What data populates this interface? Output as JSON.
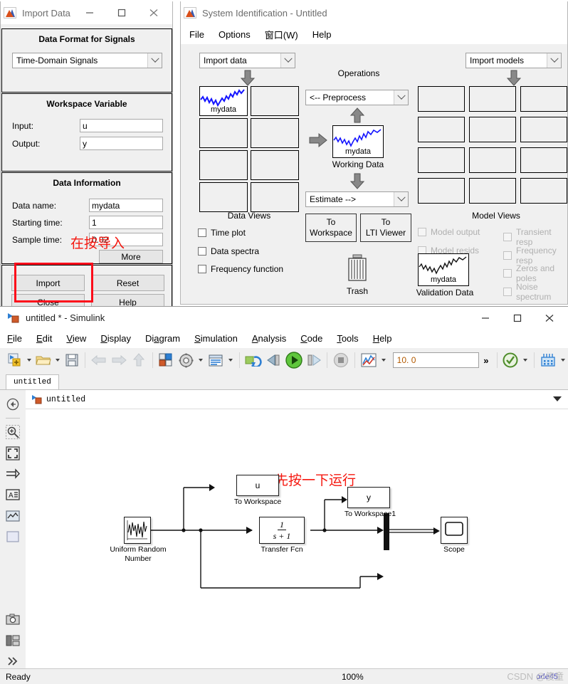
{
  "import_window": {
    "title": "Import Data",
    "icon": "matlab-icon",
    "window_controls": [
      "minimize",
      "maximize",
      "close"
    ],
    "data_format": {
      "header": "Data Format for Signals",
      "selected": "Time-Domain Signals"
    },
    "workspace_variable": {
      "header": "Workspace Variable",
      "input_label": "Input:",
      "input_value": "u",
      "output_label": "Output:",
      "output_value": "y"
    },
    "data_information": {
      "header": "Data Information",
      "data_name_label": "Data name:",
      "data_name_value": "mydata",
      "starting_time_label": "Starting time:",
      "starting_time_value": "1",
      "sample_time_label": "Sample time:",
      "sample_time_value": "0.02",
      "more_label": "More"
    },
    "buttons": {
      "import": "Import",
      "reset": "Reset",
      "close": "Close",
      "help": "Help"
    },
    "annotation": "在按导入",
    "highlight_color": "#fc0d1b"
  },
  "sysid_window": {
    "title": "System Identification - Untitled",
    "icon": "matlab-icon",
    "menus": [
      "File",
      "Options",
      "窗口(W)",
      "Help"
    ],
    "import_data_combo": "Import data",
    "import_models_combo": "Import models",
    "operations_label": "Operations",
    "preprocess_combo": "<-- Preprocess",
    "estimate_combo": "Estimate -->",
    "working_data_caption": "Working Data",
    "working_data_name": "mydata",
    "validation_data_caption": "Validation Data",
    "validation_data_name": "mydata",
    "to_workspace_button": "To Workspace",
    "to_lti_viewer_button": "To LTI Viewer",
    "trash_label": "Trash",
    "data_views": {
      "header": "Data Views",
      "items": [
        {
          "label": "Time plot",
          "checked": false,
          "enabled": true
        },
        {
          "label": "Data spectra",
          "checked": false,
          "enabled": true
        },
        {
          "label": "Frequency function",
          "checked": false,
          "enabled": true
        }
      ]
    },
    "model_views": {
      "header": "Model Views",
      "left_items": [
        {
          "label": "Model output",
          "checked": false,
          "enabled": false
        },
        {
          "label": "Model resids",
          "checked": false,
          "enabled": false
        }
      ],
      "right_items": [
        {
          "label": "Transient resp",
          "checked": false,
          "enabled": false
        },
        {
          "label": "Frequency resp",
          "checked": false,
          "enabled": false
        },
        {
          "label": "Zeros and poles",
          "checked": false,
          "enabled": false
        },
        {
          "label": "Noise spectrum",
          "checked": false,
          "enabled": false
        }
      ]
    },
    "data_board_slots": 8,
    "model_board_slots": 12
  },
  "simulink_window": {
    "title": "untitled * - Simulink",
    "icon": "simulink-icon",
    "window_controls": [
      "minimize",
      "maximize",
      "close"
    ],
    "menus": [
      {
        "label": "File",
        "mnemonic": "F"
      },
      {
        "label": "Edit",
        "mnemonic": "E"
      },
      {
        "label": "View",
        "mnemonic": "V"
      },
      {
        "label": "Display",
        "mnemonic": "D"
      },
      {
        "label": "Diagram",
        "mnemonic": "a"
      },
      {
        "label": "Simulation",
        "mnemonic": "S"
      },
      {
        "label": "Analysis",
        "mnemonic": "A"
      },
      {
        "label": "Code",
        "mnemonic": "C"
      },
      {
        "label": "Tools",
        "mnemonic": "T"
      },
      {
        "label": "Help",
        "mnemonic": "H"
      }
    ],
    "toolbar": {
      "new_model": "new-model-icon",
      "open": "open-folder-icon",
      "save": "save-icon",
      "back": "back-arrow-icon",
      "forward": "forward-arrow-icon",
      "up": "up-arrow-icon",
      "library_browser": "library-browser-icon",
      "model_config": "gear-icon",
      "model_explorer": "model-explorer-icon",
      "update_model": "update-model-icon",
      "step_back": "step-back-icon",
      "run": "run-icon",
      "step_forward": "step-forward-icon",
      "stop": "stop-icon",
      "data_inspector": "data-inspector-icon",
      "sim_stop_time": "10. 0",
      "overflow": "»",
      "check_model": "check-model-icon",
      "sample_time": "sample-time-icon"
    },
    "tab_label": "untitled",
    "breadcrumb": "untitled",
    "annotation": "先按一下运行",
    "highlight_color": "#fc0d1b",
    "left_tools": [
      "navigate-back-icon",
      "zoom-icon",
      "fit-to-view-icon",
      "route-signals-icon",
      "annotation-icon",
      "viewer-icon",
      "area-icon",
      "screenshot-icon",
      "layout-icon",
      "more-icon"
    ],
    "diagram": {
      "blocks": [
        {
          "name": "Uniform Random Number",
          "label": "Uniform Random\nNumber",
          "type": "source"
        },
        {
          "name": "To Workspace",
          "label": "To Workspace",
          "value": "u",
          "type": "sink"
        },
        {
          "name": "To Workspace1",
          "label": "To Workspace1",
          "value": "y",
          "type": "sink"
        },
        {
          "name": "Transfer Fcn",
          "label": "Transfer Fcn",
          "numerator": "1",
          "denominator": "s + 1",
          "type": "transfer-function"
        },
        {
          "name": "Mux",
          "label": "",
          "type": "mux"
        },
        {
          "name": "Scope",
          "label": "Scope",
          "type": "scope"
        }
      ]
    },
    "status": {
      "ready": "Ready",
      "zoom": "100%",
      "solver": "ode45"
    },
    "watermark": "CSDN @傻童"
  }
}
